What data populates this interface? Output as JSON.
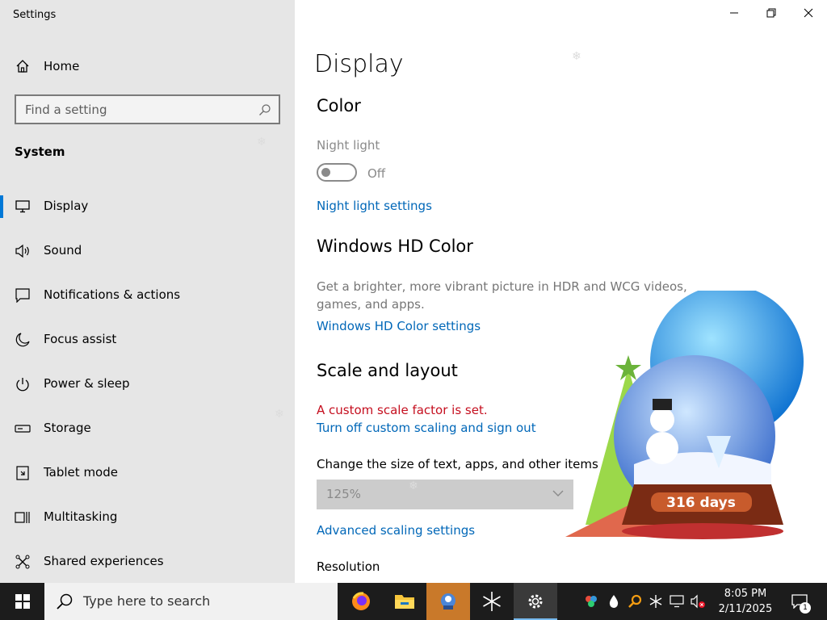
{
  "window": {
    "title": "Settings"
  },
  "sidebar": {
    "home_label": "Home",
    "search_placeholder": "Find a setting",
    "section_title": "System",
    "items": [
      {
        "label": "Display",
        "icon": "monitor-icon",
        "active": true
      },
      {
        "label": "Sound",
        "icon": "speaker-icon"
      },
      {
        "label": "Notifications & actions",
        "icon": "notification-icon"
      },
      {
        "label": "Focus assist",
        "icon": "moon-icon"
      },
      {
        "label": "Power & sleep",
        "icon": "power-icon"
      },
      {
        "label": "Storage",
        "icon": "storage-icon"
      },
      {
        "label": "Tablet mode",
        "icon": "tablet-icon"
      },
      {
        "label": "Multitasking",
        "icon": "multitasking-icon"
      },
      {
        "label": "Shared experiences",
        "icon": "shared-icon"
      }
    ]
  },
  "main": {
    "page_title": "Display",
    "color": {
      "heading": "Color",
      "night_light_label": "Night light",
      "night_light_state": "Off",
      "night_light_on": false,
      "night_light_link": "Night light settings"
    },
    "hd_color": {
      "heading": "Windows HD Color",
      "description": "Get a brighter, more vibrant picture in HDR and WCG videos, games, and apps.",
      "link": "Windows HD Color settings"
    },
    "scale": {
      "heading": "Scale and layout",
      "warning": "A custom scale factor is set.",
      "turn_off_link": "Turn off custom scaling and sign out",
      "size_label": "Change the size of text, apps, and other items",
      "size_value": "125%",
      "advanced_link": "Advanced scaling settings",
      "resolution_label": "Resolution"
    }
  },
  "widget": {
    "days_label": "316 days"
  },
  "taskbar": {
    "search_placeholder": "Type here to search",
    "apps": [
      "firefox-icon",
      "file-explorer-icon",
      "app-icon",
      "snowflake-app-icon",
      "settings-icon"
    ],
    "time": "8:05 PM",
    "date": "2/11/2025",
    "notification_count": "1"
  },
  "colors": {
    "accent": "#0078d7",
    "link": "#0067b8",
    "warning": "#c50f1f",
    "taskbar": "#1c1c1c"
  }
}
